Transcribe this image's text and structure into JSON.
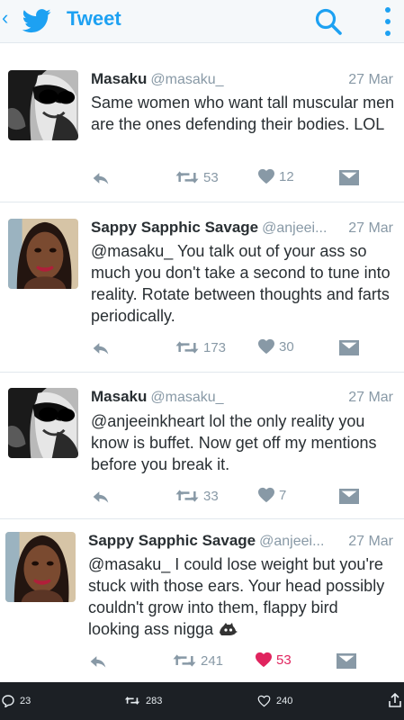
{
  "header": {
    "back_icon": "chevron-left-icon",
    "title": "Tweet",
    "accent": "#1da1f2"
  },
  "tweets": [
    {
      "avatar": "sunglasses-selfie-avatar",
      "name": "Masaku",
      "handle": "@masaku_",
      "date": "27 Mar",
      "text": "Same women who want tall muscular men are the ones defending their bodies. LOL",
      "retweets": "53",
      "likes": "12",
      "liked": false
    },
    {
      "avatar": "smiling-woman-avatar",
      "name": "Sappy Sapphic Savage",
      "handle": "@anjeei...",
      "date": "27 Mar",
      "text": "@masaku_ You talk out of your ass so much you don't take a second to tune into reality. Rotate between thoughts and farts periodically.",
      "retweets": "173",
      "likes": "30",
      "liked": false
    },
    {
      "avatar": "sunglasses-selfie-avatar",
      "name": "Masaku",
      "handle": "@masaku_",
      "date": "27 Mar",
      "text": "@anjeeinkheart lol the only reality you know is buffet. Now get off my mentions before you break it.",
      "retweets": "33",
      "likes": "7",
      "liked": false
    },
    {
      "avatar": "smiling-woman-avatar",
      "name": "Sappy Sapphic Savage",
      "handle": "@anjeei...",
      "date": "27 Mar",
      "text": "@masaku_ I could lose weight but you're stuck with those ears. Your head possibly couldn't grow into them, flappy bird looking ass nigga",
      "emoji": "bird-emoji",
      "retweets": "241",
      "likes": "53",
      "liked": true
    }
  ],
  "colors": {
    "like_active": "#e0245e",
    "muted": "#8899a6",
    "text": "#292f33"
  },
  "bottom_bar": {
    "replies": "23",
    "retweets": "283",
    "likes": "240"
  }
}
